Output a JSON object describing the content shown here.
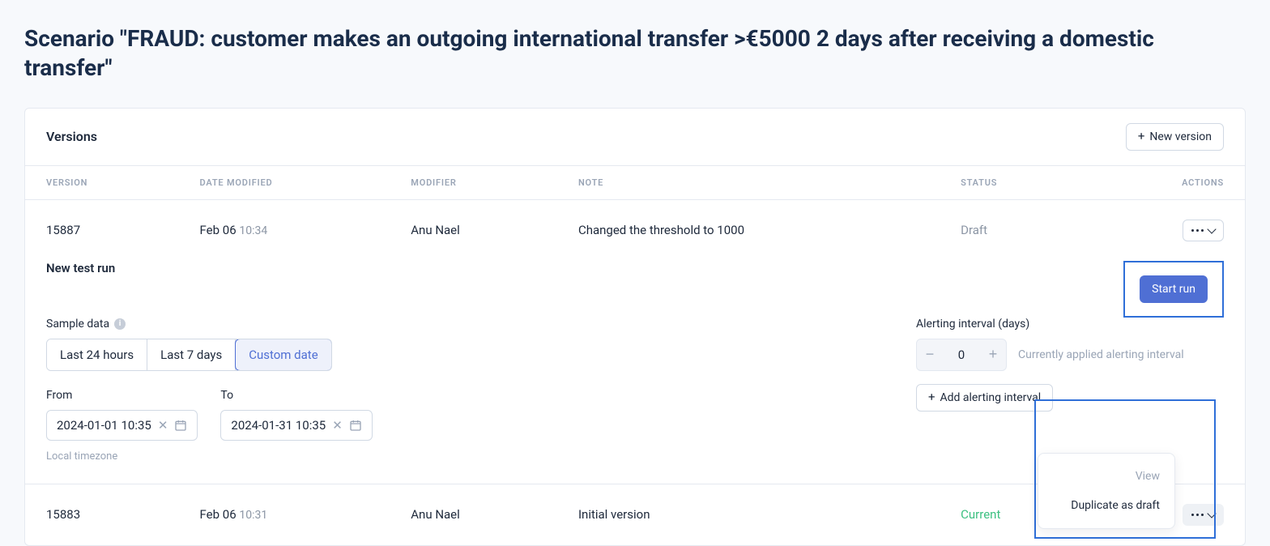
{
  "page_title": "Scenario \"FRAUD: customer makes an outgoing international transfer >€5000 2 days after receiving a domestic transfer\"",
  "versions_header": "Versions",
  "new_version_label": "New version",
  "columns": {
    "version": "VERSION",
    "date_modified": "DATE MODIFIED",
    "modifier": "MODIFIER",
    "note": "NOTE",
    "status": "STATUS",
    "actions": "ACTIONS"
  },
  "rows": [
    {
      "version": "15887",
      "date": "Feb 06",
      "time": "10:34",
      "modifier": "Anu Nael",
      "note": "Changed the threshold to 1000",
      "status": "Draft",
      "status_class": "status-draft"
    },
    {
      "version": "15883",
      "date": "Feb 06",
      "time": "10:31",
      "modifier": "Anu Nael",
      "note": "Initial version",
      "status": "Current",
      "status_class": "status-current"
    }
  ],
  "testrun": {
    "title": "New test run",
    "sample_label": "Sample data",
    "segments": {
      "last24": "Last 24 hours",
      "last7": "Last 7 days",
      "custom": "Custom date"
    },
    "from_label": "From",
    "to_label": "To",
    "from_value": "2024-01-01 10:35",
    "to_value": "2024-01-31 10:35",
    "tz_hint": "Local timezone",
    "alerting_label": "Alerting interval (days)",
    "interval_value": "0",
    "interval_hint": "Currently applied alerting interval",
    "add_interval_label": "Add alerting interval",
    "start_label": "Start run"
  },
  "dropdown": {
    "view": "View",
    "duplicate": "Duplicate as draft"
  }
}
